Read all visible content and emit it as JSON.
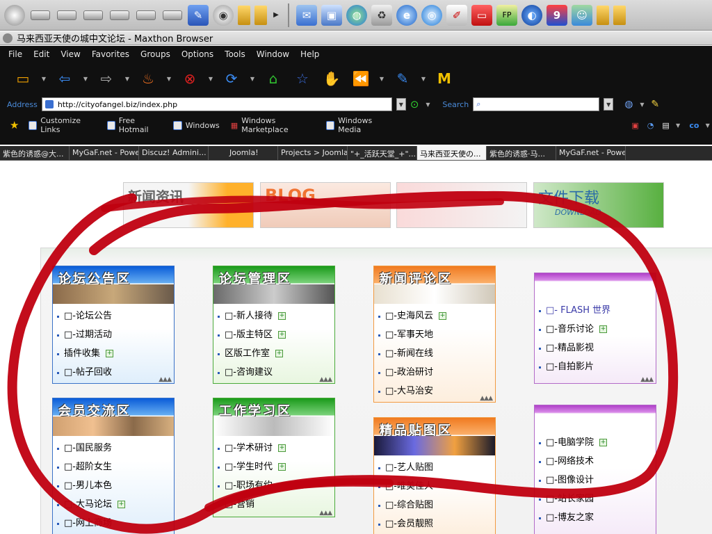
{
  "launchbar": {
    "icons": [
      "dvd-drive-icon",
      "drive-icon",
      "drive-icon",
      "drive-icon",
      "drive-icon",
      "drive-icon",
      "drive-icon",
      "notepad-icon",
      "webcam-icon",
      "folder-icon",
      "folder-icon",
      "more-arrow-icon",
      "mail-icon",
      "computer-icon",
      "globe-network-icon",
      "recycle-bin-icon",
      "internet-explorer-icon",
      "outlook-icon",
      "notepad-icon",
      "tv-icon",
      "fp-icon",
      "earth-icon",
      "nine-icon",
      "users-icon",
      "folder-icon",
      "folder-icon"
    ]
  },
  "window": {
    "title": "马来西亚天使の城中文论坛 - Maxthon Browser"
  },
  "menu": [
    "File",
    "Edit",
    "View",
    "Favorites",
    "Groups",
    "Options",
    "Tools",
    "Window",
    "Help"
  ],
  "address": {
    "label": "Address",
    "url": "http://cityofangel.biz/index.php",
    "search_label": "Search"
  },
  "links": [
    "Customize Links",
    "Free Hotmail",
    "Windows",
    "Windows Marketplace",
    "Windows Media"
  ],
  "tabs": [
    "紫色的诱惑@大...",
    "MyGaF.net - Powe...",
    "Discuz! Admini...",
    "Joomla!",
    "Projects > Joomla! >",
    "\"+_活跃天堂_+\"...",
    "马来西亚天使の...",
    "紫色的诱惑·马...",
    "MyGaF.net - Powe..."
  ],
  "active_tab_index": 6,
  "banners": {
    "news": "新闻资讯",
    "blog": "BLOG",
    "download": "文件下载",
    "download_sub": "DOWNLOAD"
  },
  "panels": {
    "announce": {
      "title": "论坛公告区",
      "items": [
        "□-论坛公告",
        "□-过期活动",
        "插件收集",
        "□-帖子回收"
      ]
    },
    "manage": {
      "title": "论坛管理区",
      "items": [
        "□-新人接待",
        "□-版主特区",
        "区版工作室",
        "□-咨询建议"
      ]
    },
    "news": {
      "title": "新闻评论区",
      "items": [
        "□-史海风云",
        "□-军事天地",
        "□-新闻在线",
        "□-政治研讨",
        "□-大马治安"
      ]
    },
    "flash": {
      "items": [
        "□- FLASH 世界",
        "□-音乐讨论",
        "□-精品影视",
        "□-自拍影片"
      ]
    },
    "member": {
      "title": "会员交流区",
      "items": [
        "□-国民服务",
        "□-超阶女生",
        "□-男儿本色",
        "□-大马论坛",
        "□-网上商场"
      ]
    },
    "work": {
      "title": "工作学习区",
      "items": [
        "□-学术研讨",
        "□-学生时代",
        "□-职场有约",
        "□-营销"
      ]
    },
    "picture": {
      "title": "精品贴图区",
      "items": [
        "□-艺人贴图",
        "□-唯美佳人",
        "□-综合贴图",
        "□-会员靓照"
      ]
    },
    "computer": {
      "items": [
        "□-电脑学院",
        "□-网络技术",
        "□-图像设计",
        "□-站长家园",
        "□-博友之家"
      ]
    }
  },
  "colors": {
    "chrome_bg": "#101010",
    "ink": "#c00010",
    "blue_panel": "#3a72c8",
    "green_panel": "#4aaa3a",
    "orange_panel": "#f29a40",
    "purple_panel": "#b26ac8"
  }
}
